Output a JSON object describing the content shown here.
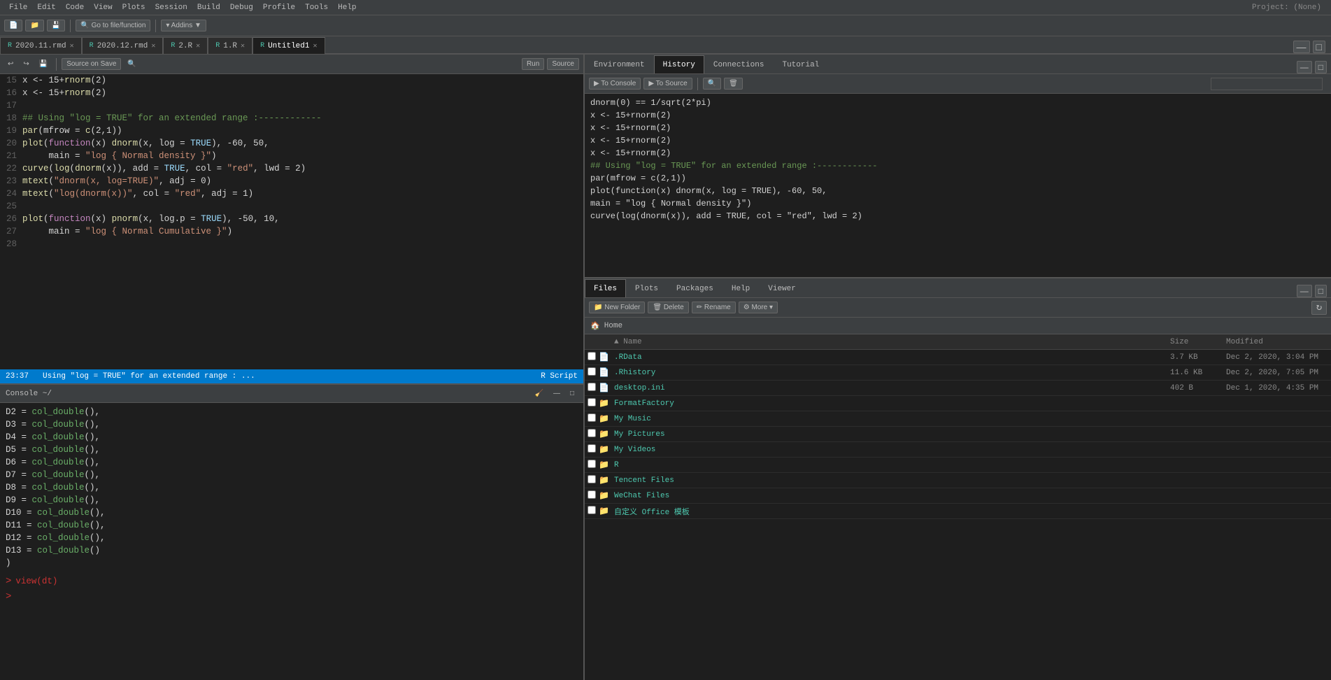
{
  "menubar": {
    "items": [
      "File",
      "Edit",
      "Code",
      "View",
      "Plots",
      "Session",
      "Build",
      "Debug",
      "Profile",
      "Tools",
      "Help"
    ]
  },
  "project_badge": "Project: (None)",
  "tabs": [
    {
      "label": "2020.11.rmd",
      "active": false,
      "icon": "R"
    },
    {
      "label": "2020.12.rmd",
      "active": false,
      "icon": "R"
    },
    {
      "label": "2.R",
      "active": false,
      "icon": "R"
    },
    {
      "label": "1.R",
      "active": false,
      "icon": "R"
    },
    {
      "label": "Untitled1",
      "active": true,
      "icon": "R"
    }
  ],
  "editor_toolbar": {
    "source_on_save": "Source on Save",
    "run_label": "Run",
    "source_label": "Source"
  },
  "code_lines": [
    {
      "num": "15",
      "content": "x <- 15+rnorm(2)"
    },
    {
      "num": "16",
      "content": "x <- 15+rnorm(2)"
    },
    {
      "num": "17",
      "content": ""
    },
    {
      "num": "18",
      "content": "## Using \"log = TRUE\" for an extended range :------------"
    },
    {
      "num": "19",
      "content": "par(mfrow = c(2,1))"
    },
    {
      "num": "20",
      "content": "plot(function(x) dnorm(x, log = TRUE), -60, 50,"
    },
    {
      "num": "21",
      "content": "     main = \"log { Normal density }\")"
    },
    {
      "num": "22",
      "content": "curve(log(dnorm(x)), add = TRUE, col = \"red\", lwd = 2)"
    },
    {
      "num": "23",
      "content": "mtext(\"dnorm(x, log=TRUE)\", adj = 0)"
    },
    {
      "num": "24",
      "content": "mtext(\"log(dnorm(x))\", col = \"red\", adj = 1)"
    },
    {
      "num": "25",
      "content": ""
    },
    {
      "num": "26",
      "content": "plot(function(x) pnorm(x, log.p = TRUE), -50, 10,"
    },
    {
      "num": "27",
      "content": "     main = \"log { Normal Cumulative }\")"
    },
    {
      "num": "28",
      "content": ""
    }
  ],
  "status_bar": {
    "position": "23:37",
    "message": "Using \"log = TRUE\" for an extended range : ...",
    "script_type": "R Script"
  },
  "console": {
    "title": "Console ~/",
    "lines": [
      "D2  = col_double(),",
      "D3  = col_double(),",
      "D4  = col_double(),",
      "D5  = col_double(),",
      "D6  = col_double(),",
      "D7  = col_double(),",
      "D8  = col_double(),",
      "D9  = col_double(),",
      "D10 = col_double(),",
      "D11 = col_double(),",
      "D12 = col_double(),",
      "D13 = col_double()"
    ],
    "end_line": ")",
    "prompt_line": "view(dt)",
    "prompt": ">"
  },
  "right_panel": {
    "tabs": [
      "Environment",
      "History",
      "Connections",
      "Tutorial"
    ],
    "active_tab": "History",
    "toolbar_btns": [
      "To Console",
      "To Source"
    ],
    "history_lines": [
      "dnorm(0) == 1/sqrt(2*pi)",
      "x <- 15+rnorm(2)",
      "x <- 15+rnorm(2)",
      "x <- 15+rnorm(2)",
      "x <- 15+rnorm(2)",
      "## Using \"log = TRUE\" for an extended range :------------",
      "par(mfrow = c(2,1))",
      "plot(function(x) dnorm(x, log = TRUE), -60, 50,",
      "main = \"log { Normal density }\")",
      "curve(log(dnorm(x)), add = TRUE, col = \"red\", lwd = 2)"
    ]
  },
  "files_panel": {
    "tabs": [
      "Files",
      "Plots",
      "Packages",
      "Help",
      "Viewer"
    ],
    "active_tab": "Files",
    "toolbar_btns": [
      "New Folder",
      "Delete",
      "Rename",
      "More"
    ],
    "path": "Home",
    "columns": [
      "Name",
      "Size",
      "Modified"
    ],
    "files": [
      {
        "name": ".RData",
        "type": "file",
        "size": "3.7 KB",
        "modified": "Dec 2, 2020, 3:04 PM"
      },
      {
        "name": ".Rhistory",
        "type": "file",
        "size": "11.6 KB",
        "modified": "Dec 2, 2020, 7:05 PM"
      },
      {
        "name": "desktop.ini",
        "type": "file",
        "size": "402 B",
        "modified": "Dec 1, 2020, 4:35 PM"
      },
      {
        "name": "FormatFactory",
        "type": "folder",
        "size": "",
        "modified": ""
      },
      {
        "name": "My Music",
        "type": "folder",
        "size": "",
        "modified": ""
      },
      {
        "name": "My Pictures",
        "type": "folder",
        "size": "",
        "modified": ""
      },
      {
        "name": "My Videos",
        "type": "folder",
        "size": "",
        "modified": ""
      },
      {
        "name": "R",
        "type": "folder",
        "size": "",
        "modified": ""
      },
      {
        "name": "Tencent Files",
        "type": "folder",
        "size": "",
        "modified": ""
      },
      {
        "name": "WeChat Files",
        "type": "folder",
        "size": "",
        "modified": ""
      },
      {
        "name": "自定义 Office 模板",
        "type": "folder",
        "size": "",
        "modified": ""
      }
    ]
  }
}
